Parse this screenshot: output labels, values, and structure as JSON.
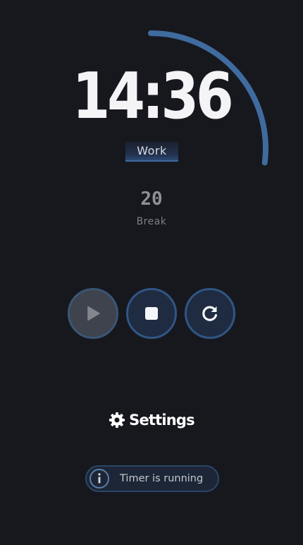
{
  "timer": {
    "time": "14:36",
    "mode": "Work",
    "progress_fraction": 0.27
  },
  "next": {
    "duration": "20",
    "mode": "Break"
  },
  "controls": {
    "play_icon": "play-icon",
    "stop_icon": "stop-icon",
    "reset_icon": "reset-icon"
  },
  "settings": {
    "label": "Settings",
    "icon": "gear-icon"
  },
  "status": {
    "text": "Timer is running",
    "icon": "info-icon"
  },
  "colors": {
    "background": "#17181e",
    "accent": "#3e6aa0",
    "progress": "#3f6b9f"
  }
}
